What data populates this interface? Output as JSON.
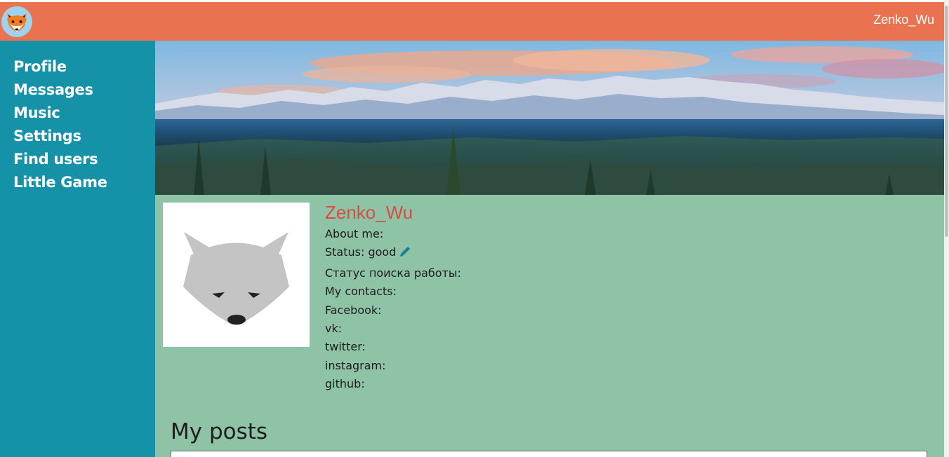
{
  "header": {
    "username": "Zenko_Wu"
  },
  "sidebar": {
    "items": [
      {
        "label": "Profile"
      },
      {
        "label": "Messages"
      },
      {
        "label": "Music"
      },
      {
        "label": "Settings"
      },
      {
        "label": "Find users"
      },
      {
        "label": "Little Game"
      }
    ]
  },
  "profile": {
    "name": "Zenko_Wu",
    "about": "About me:",
    "status": "Status: good",
    "job_search": "Статус поиска работы:",
    "contacts": "My contacts:",
    "facebook": "Facebook:",
    "vk": "vk:",
    "twitter": "twitter:",
    "instagram": "instagram:",
    "github": "github:"
  },
  "posts": {
    "title": "My posts",
    "input_value": ""
  },
  "colors": {
    "header": "#e97350",
    "sidebar": "#1592a8",
    "content": "#8fc3a6",
    "name": "#d94c45",
    "edit_icon": "#1a7f96"
  }
}
